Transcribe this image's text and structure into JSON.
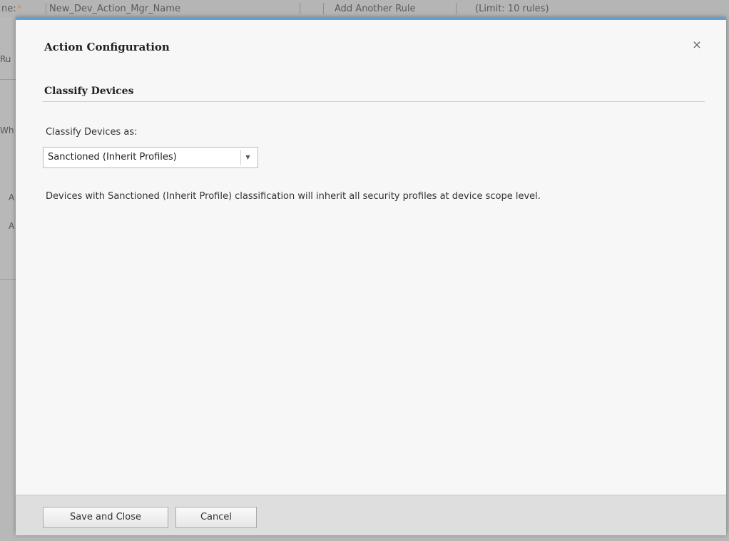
{
  "background": {
    "name_label": "ne:",
    "required_mark": "*",
    "name_value": "New_Dev_Action_Mgr_Name",
    "add_rule": "Add Another Rule",
    "limit": "(Limit: 10 rules)",
    "side_labels": [
      "Ru",
      "Wh",
      "A",
      "A"
    ]
  },
  "modal": {
    "title": "Action Configuration",
    "close_glyph": "×",
    "section_title": "Classify Devices",
    "field_label": "Classify Devices as:",
    "select_value": "Sanctioned (Inherit Profiles)",
    "select_arrow_glyph": "▼",
    "description": "Devices with Sanctioned (Inherit Profile) classification will inherit all security profiles at device scope level."
  },
  "footer": {
    "save_label": "Save and Close",
    "cancel_label": "Cancel"
  },
  "colors": {
    "accent": "#5fa1d6",
    "required": "#d98b4a"
  }
}
